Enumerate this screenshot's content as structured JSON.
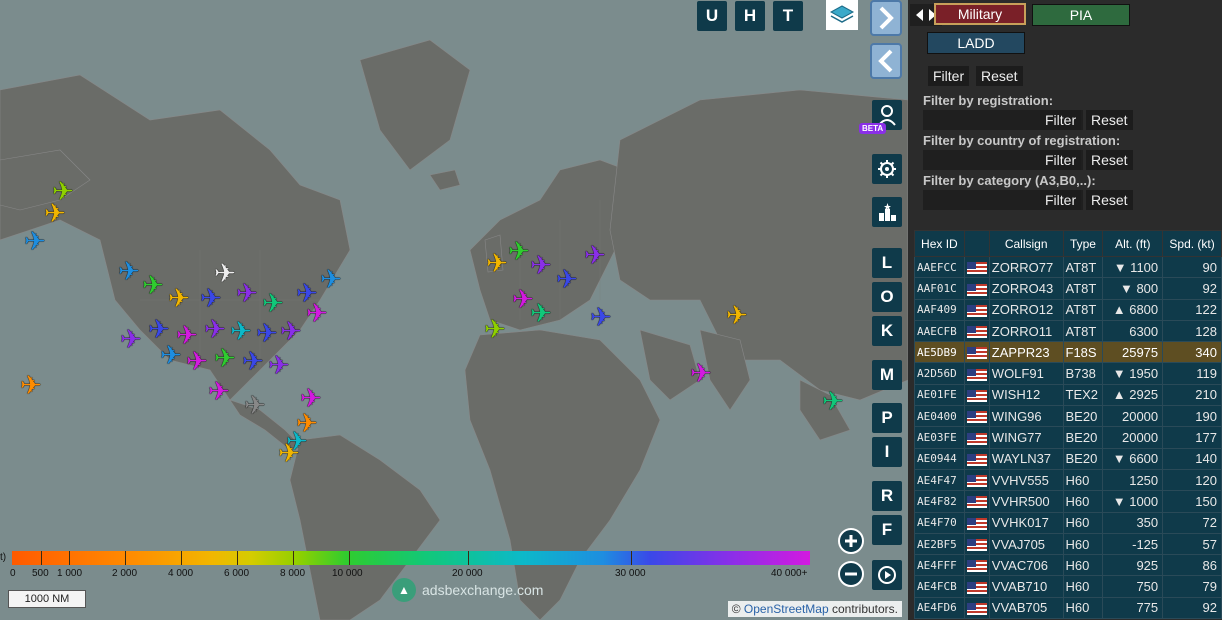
{
  "map": {
    "top_buttons": [
      "U",
      "H",
      "T"
    ],
    "side_buttons": [
      "L",
      "O",
      "K",
      "M",
      "P",
      "I",
      "R",
      "F"
    ],
    "beta_label": "BETA",
    "scale_label": "1000 NM",
    "logo_text": "adsbexchange.com",
    "attribution_prefix": "©",
    "attribution_link": "OpenStreetMap",
    "attribution_suffix": "contributors.",
    "altitude_unit_fragment": "t)",
    "altitude_ticks": [
      "0",
      "500",
      "1 000",
      "2 000",
      "4 000",
      "6 000",
      "8 000",
      "10 000",
      "20 000",
      "30 000",
      "40 000+"
    ],
    "water_color": "#7b8c8d",
    "land_color": "#6a6c68"
  },
  "sidebar": {
    "chips": {
      "military": "Military",
      "pia": "PIA",
      "ladd": "LADD"
    },
    "filter_label": "Filter",
    "reset_label": "Reset",
    "filter_by_registration": "Filter by registration:",
    "filter_by_country": "Filter by country of registration:",
    "filter_by_category": "Filter by category (A3,B0,..):"
  },
  "table": {
    "headers": [
      "Hex ID",
      "",
      "Callsign",
      "Type",
      "Alt. (ft)",
      "Spd. (kt)"
    ],
    "rows": [
      {
        "hex": "AAEFCC",
        "callsign": "ZORRO77",
        "type": "AT8T",
        "alt": "▼  1100",
        "spd": "90"
      },
      {
        "hex": "AAF01C",
        "callsign": "ZORRO43",
        "type": "AT8T",
        "alt": "▼   800",
        "spd": "92"
      },
      {
        "hex": "AAF409",
        "callsign": "ZORRO12",
        "type": "AT8T",
        "alt": "▲  6800",
        "spd": "122"
      },
      {
        "hex": "AAECFB",
        "callsign": "ZORRO11",
        "type": "AT8T",
        "alt": "6300",
        "spd": "128"
      },
      {
        "hex": "AE5DB9",
        "callsign": "ZAPPR23",
        "type": "F18S",
        "alt": "25975",
        "spd": "340"
      },
      {
        "hex": "A2D56D",
        "callsign": "WOLF91",
        "type": "B738",
        "alt": "▼  1950",
        "spd": "119"
      },
      {
        "hex": "AE01FE",
        "callsign": "WISH12",
        "type": "TEX2",
        "alt": "▲  2925",
        "spd": "210"
      },
      {
        "hex": "AE0400",
        "callsign": "WING96",
        "type": "BE20",
        "alt": "20000",
        "spd": "190"
      },
      {
        "hex": "AE03FE",
        "callsign": "WING77",
        "type": "BE20",
        "alt": "20000",
        "spd": "177"
      },
      {
        "hex": "AE0944",
        "callsign": "WAYLN37",
        "type": "BE20",
        "alt": "▼  6600",
        "spd": "140"
      },
      {
        "hex": "AE4F47",
        "callsign": "VVHV555",
        "type": "H60",
        "alt": "1250",
        "spd": "120"
      },
      {
        "hex": "AE4F82",
        "callsign": "VVHR500",
        "type": "H60",
        "alt": "▼  1000",
        "spd": "150"
      },
      {
        "hex": "AE4F70",
        "callsign": "VVHK017",
        "type": "H60",
        "alt": "350",
        "spd": "72"
      },
      {
        "hex": "AE2BF5",
        "callsign": "VVAJ705",
        "type": "H60",
        "alt": "-125",
        "spd": "57"
      },
      {
        "hex": "AE4FFF",
        "callsign": "VVAC706",
        "type": "H60",
        "alt": "925",
        "spd": "86"
      },
      {
        "hex": "AE4FCB",
        "callsign": "VVAB710",
        "type": "H60",
        "alt": "750",
        "spd": "79"
      },
      {
        "hex": "AE4FD6",
        "callsign": "VVAB705",
        "type": "H60",
        "alt": "775",
        "spd": "92"
      }
    ]
  }
}
